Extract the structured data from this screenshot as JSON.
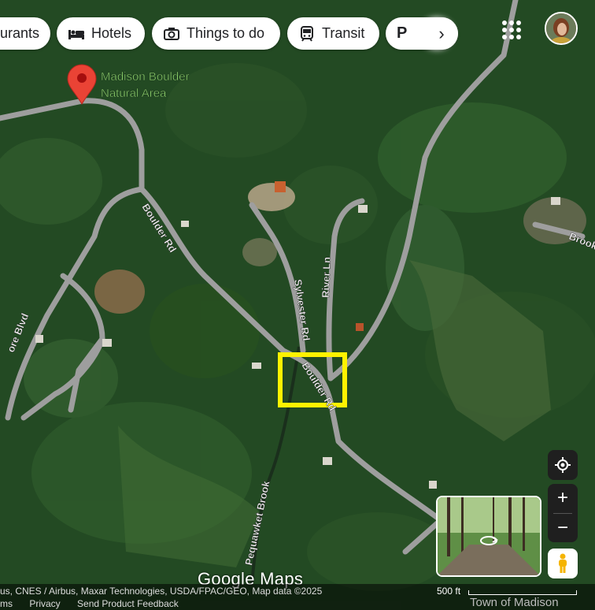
{
  "top_bar": {
    "chips": [
      {
        "label": "urants",
        "icon": "fork-knife-icon"
      },
      {
        "label": "Hotels",
        "icon": "bed-icon"
      },
      {
        "label": "Things to do",
        "icon": "camera-icon"
      },
      {
        "label": "Transit",
        "icon": "train-icon"
      },
      {
        "label": "P",
        "icon": "parking-icon"
      }
    ],
    "more_icon": "chevron-right-icon",
    "apps_icon": "apps-grid-icon",
    "avatar_icon": "account-avatar"
  },
  "map": {
    "view": "satellite",
    "place_pin": {
      "name": "Madison Boulder Natural Area",
      "color": "#ea4335",
      "label_color": "#8bd16a"
    },
    "road_labels": [
      "Boulder Rd",
      "Sylvester Rd",
      "River Ln",
      "Boulder Rd",
      "Brook",
      "ore Blvd",
      "Pequawket Brook"
    ],
    "highlight": {
      "color": "#fff200",
      "shape": "square"
    },
    "road_color": "#9e9e9e"
  },
  "controls": {
    "locate_icon": "my-location-icon",
    "zoom_in": "+",
    "zoom_out": "−",
    "pegman_icon": "pegman-icon",
    "streetview_icon": "rotate-360-icon"
  },
  "footer": {
    "google_logo": "Google Maps",
    "attribution": "us, CNES / Airbus, Maxar Technologies, USDA/FPAC/GEO, Map data ©2025",
    "links": [
      "ms",
      "Privacy",
      "Send Product Feedback"
    ],
    "scale": "500 ft",
    "town": "Town of Madison"
  }
}
